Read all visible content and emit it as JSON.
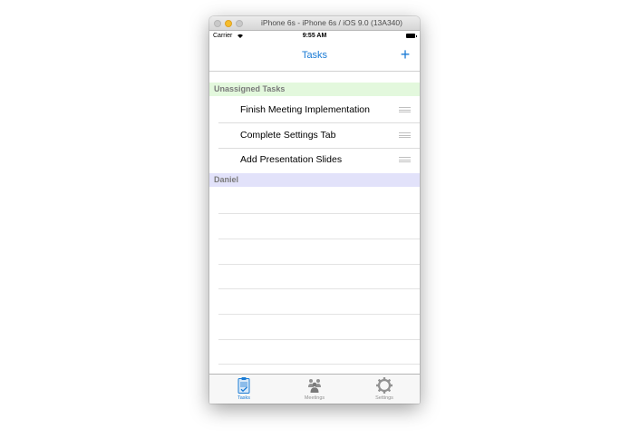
{
  "window": {
    "title": "iPhone 6s - iPhone 6s / iOS 9.0 (13A340)"
  },
  "status_bar": {
    "carrier": "Carrier",
    "wifi_icon": "wifi-icon",
    "time": "9:55 AM",
    "battery_icon": "battery-icon"
  },
  "nav_bar": {
    "title": "Tasks",
    "add_icon": "plus-icon",
    "add_label": "+"
  },
  "sections": [
    {
      "header": "Unassigned Tasks",
      "color": "#e3f8dd",
      "tasks": [
        "Finish Meeting Implementation",
        "Complete Settings Tab",
        "Add Presentation Slides"
      ]
    },
    {
      "header": "Daniel",
      "color": "#e2e2fa",
      "tasks": []
    }
  ],
  "tab_bar": {
    "items": [
      {
        "label": "Tasks",
        "icon": "clipboard-check-icon",
        "active": true
      },
      {
        "label": "Meetings",
        "icon": "people-group-icon",
        "active": false
      },
      {
        "label": "Settings",
        "icon": "gear-icon",
        "active": false
      }
    ]
  },
  "colors": {
    "accent": "#1a7bd5",
    "inactive": "#929292"
  }
}
